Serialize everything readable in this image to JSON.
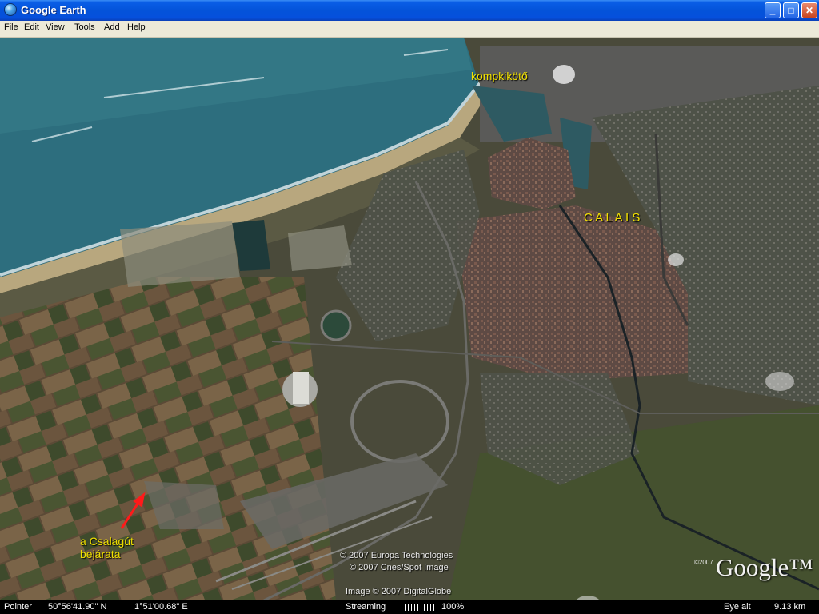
{
  "window": {
    "title": "Google Earth",
    "minimize_label": "_",
    "maximize_label": "□",
    "close_label": "✕"
  },
  "menu": [
    "File",
    "Edit",
    "View",
    "Tools",
    "Add",
    "Help"
  ],
  "map": {
    "labels": {
      "ferry_port": "kompkikötő",
      "city": "C A L A I S",
      "tunnel_line1": "a Csalagút",
      "tunnel_line2": "bejárata"
    },
    "credits": [
      "© 2007 Europa Technologies",
      "© 2007 Cnes/Spot Image",
      "Image © 2007 DigitalGlobe"
    ],
    "logo": {
      "year": "©2007",
      "text": "Google™"
    },
    "arrow_color": "#ff1a1a",
    "label_color": "#f2e100"
  },
  "status": {
    "pointer_label": "Pointer",
    "latitude": "50°56'41.90\" N",
    "longitude": "1°51'00.68\" E",
    "streaming_label": "Streaming",
    "streaming_percent": "100%",
    "eye_alt_label": "Eye alt",
    "eye_alt_value": "9.13 km"
  },
  "colors": {
    "titlebar": "#0453d9",
    "menubar": "#ece9d8",
    "sea": "#2d6e7e",
    "beach": "#b8a77e"
  }
}
